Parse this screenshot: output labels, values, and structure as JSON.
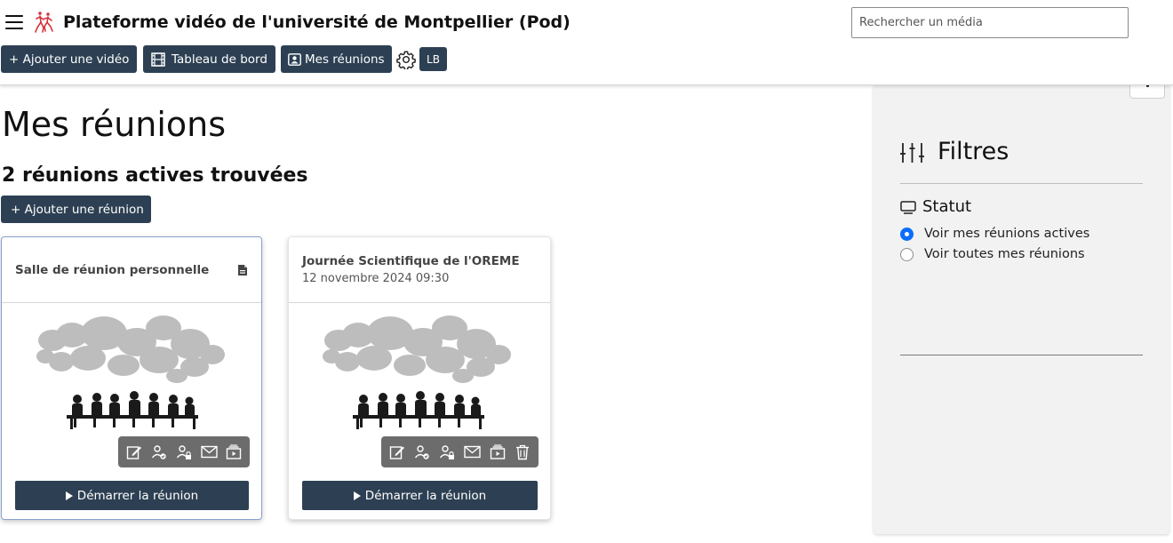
{
  "header": {
    "site_title": "Plateforme vidéo de l'université de Montpellier (Pod)",
    "search_placeholder": "Rechercher un média",
    "buttons": {
      "add_video": "+ Ajouter une vidéo",
      "dashboard": "Tableau de bord",
      "my_meetings": "Mes réunions"
    },
    "user_initials": "LB"
  },
  "main": {
    "page_title": "Mes réunions",
    "results_count": "2 réunions actives trouvées",
    "add_meeting_label": "+ Ajouter une réunion",
    "meetings": [
      {
        "title": "Salle de réunion personnelle",
        "date": "",
        "start_label": "Démarrer la réunion",
        "actions": [
          "edit-icon",
          "user-check-icon",
          "user-lock-icon",
          "mail-icon",
          "recordings-icon"
        ]
      },
      {
        "title": "Journée Scientifique de l'OREME",
        "date": "12 novembre 2024 09:30",
        "start_label": "Démarrer la réunion",
        "actions": [
          "edit-icon",
          "user-check-icon",
          "user-lock-icon",
          "mail-icon",
          "recordings-icon",
          "trash-icon"
        ]
      }
    ]
  },
  "sidebar": {
    "filters_title": "Filtres",
    "status_title": "Statut",
    "options": [
      {
        "label": "Voir mes réunions actives",
        "selected": true
      },
      {
        "label": "Voir toutes mes réunions",
        "selected": false
      }
    ]
  },
  "colors": {
    "primary_button": "#2d4053",
    "action_bar": "#6c6c6c",
    "radio_selected": "#0b6efd",
    "sidebar_bg": "#f2f2f2",
    "logo": "#d6313b"
  }
}
